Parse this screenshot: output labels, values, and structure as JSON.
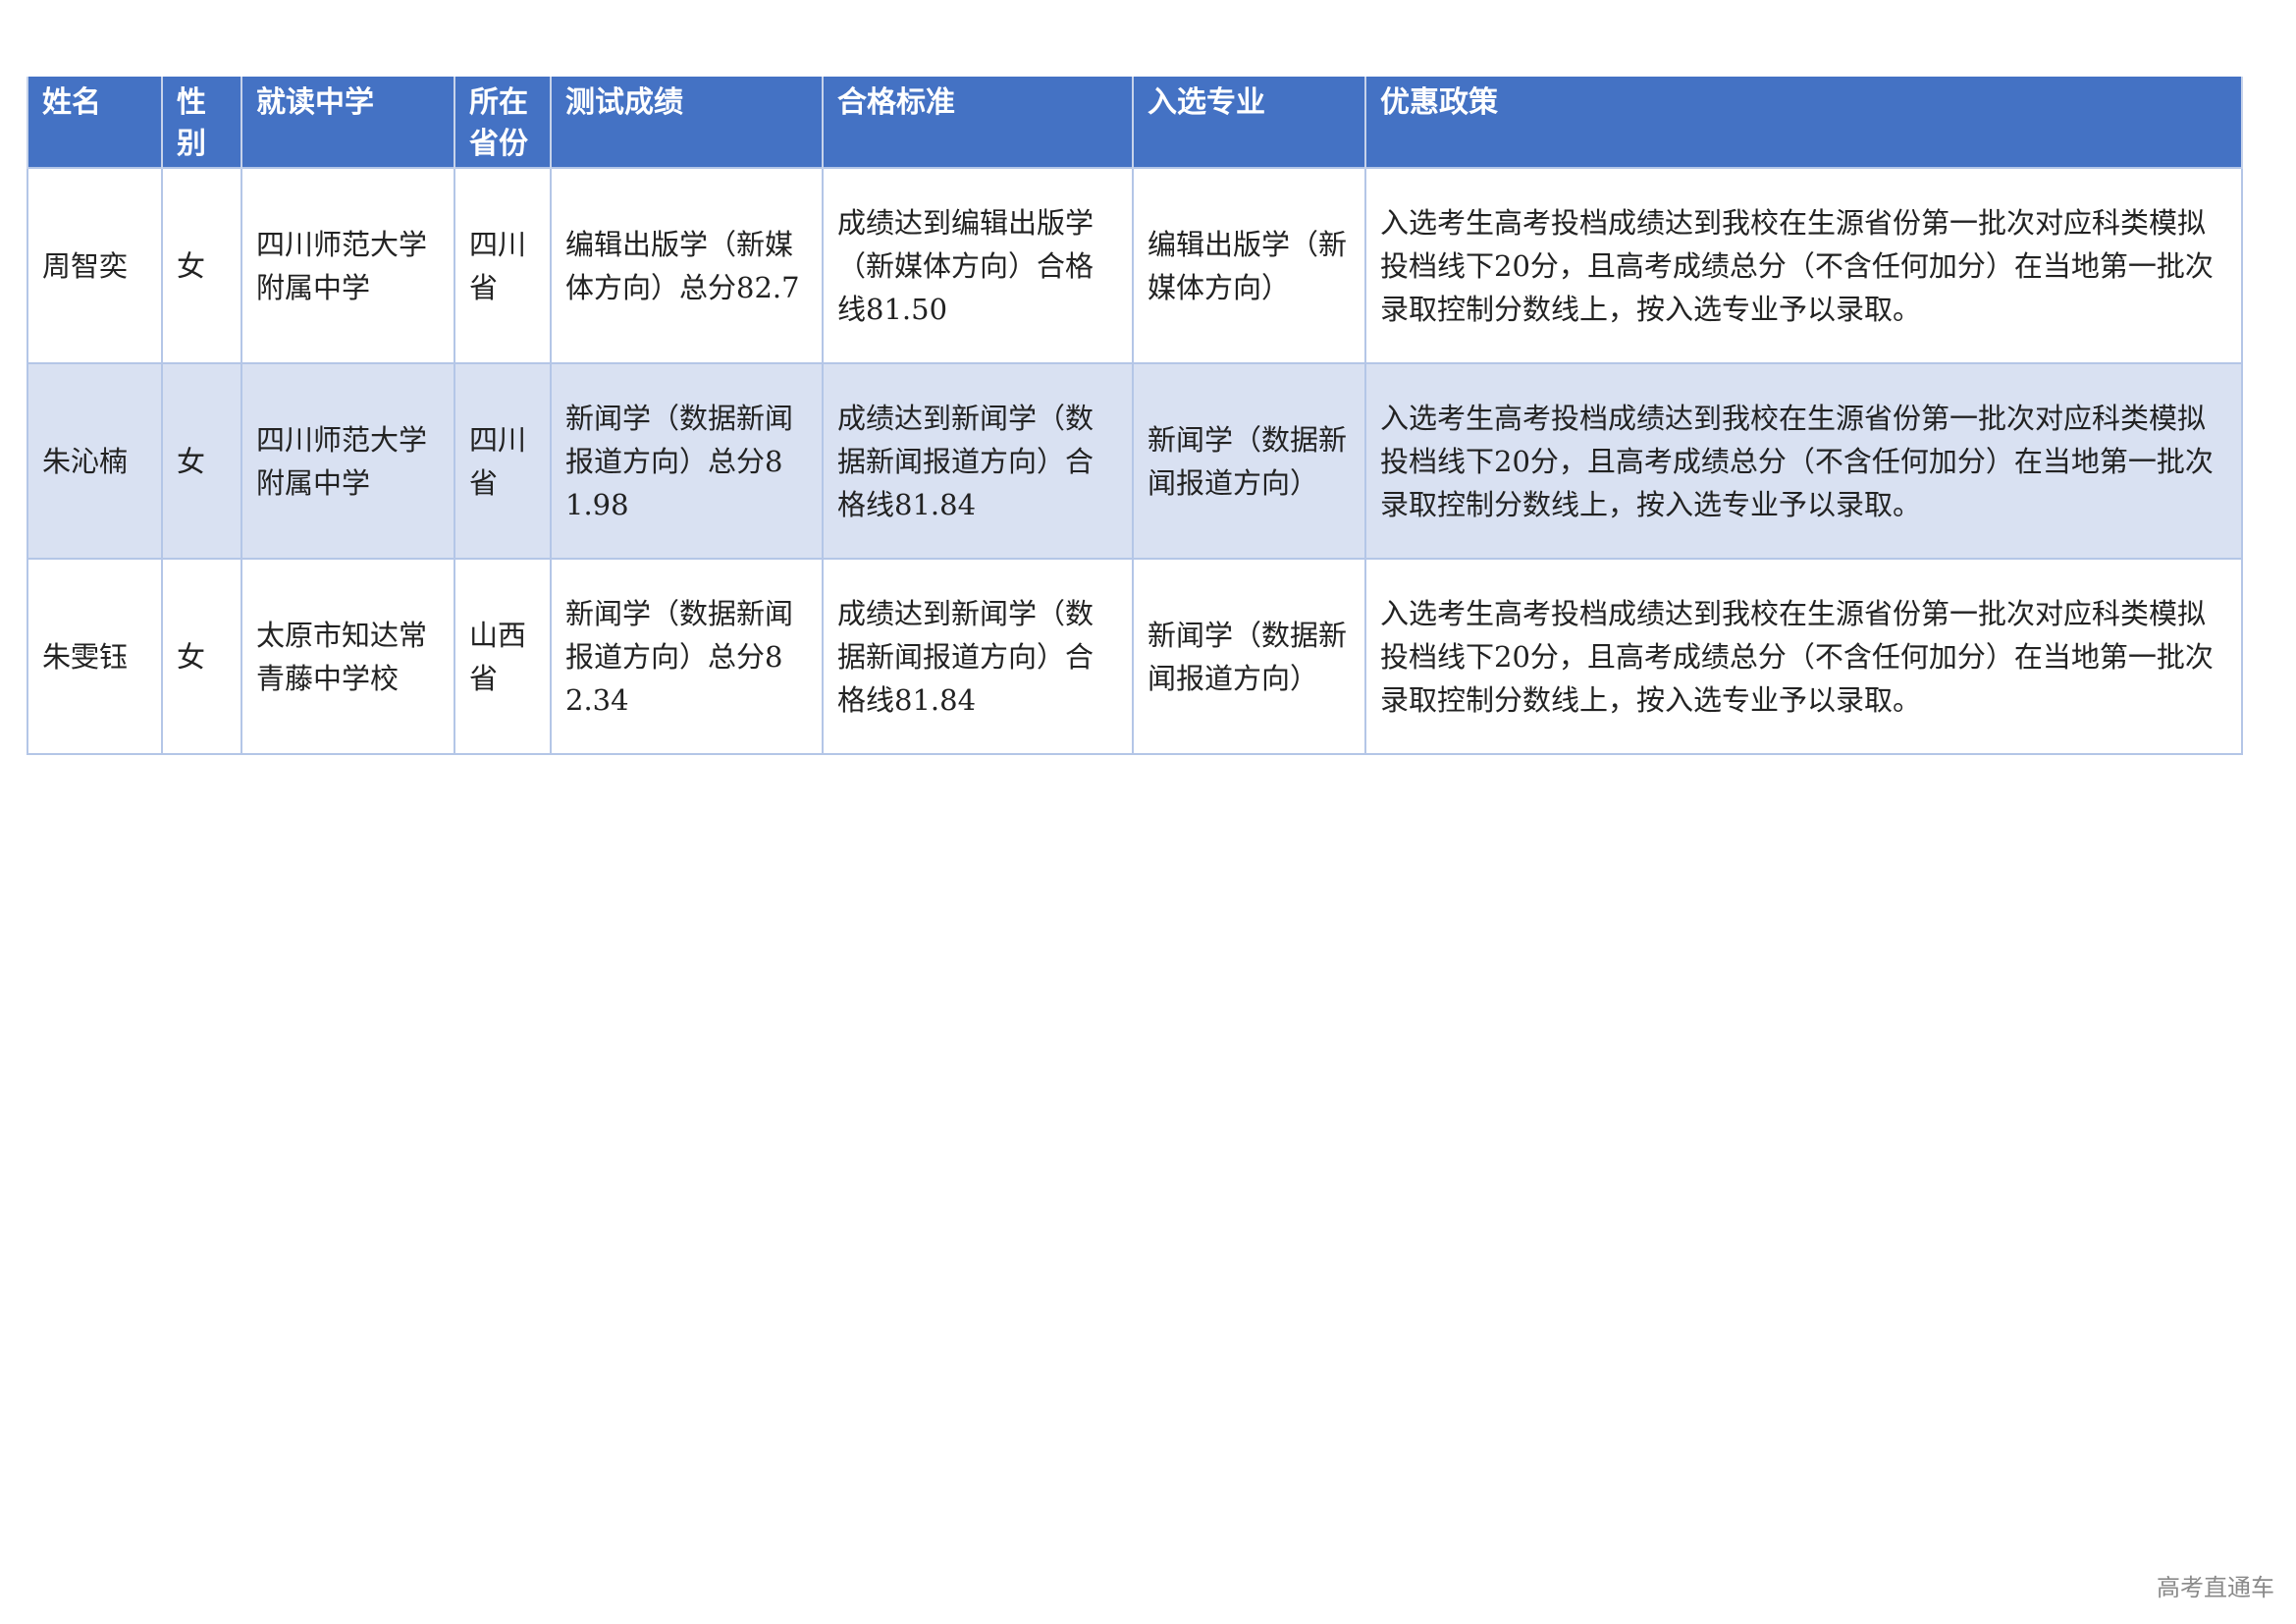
{
  "table": {
    "headers": {
      "name": "姓名",
      "gender": "性别",
      "school": "就读中学",
      "province": "所在省份",
      "score": "测试成绩",
      "standard": "合格标准",
      "major": "入选专业",
      "policy": "优惠政策"
    },
    "rows": [
      {
        "name": "周智奕",
        "gender": "女",
        "school": "四川师范大学附属中学",
        "province": "四川省",
        "score": "编辑出版学（新媒体方向）总分82.7",
        "standard": "成绩达到编辑出版学（新媒体方向）合格线81.50",
        "major": "编辑出版学（新媒体方向）",
        "policy": "入选考生高考投档成绩达到我校在生源省份第一批次对应科类模拟投档线下20分，且高考成绩总分（不含任何加分）在当地第一批次录取控制分数线上，按入选专业予以录取。"
      },
      {
        "name": "朱沁楠",
        "gender": "女",
        "school": "四川师范大学附属中学",
        "province": "四川省",
        "score": "新闻学（数据新闻报道方向）总分81.98",
        "standard": "成绩达到新闻学（数据新闻报道方向）合格线81.84",
        "major": "新闻学（数据新闻报道方向）",
        "policy": "入选考生高考投档成绩达到我校在生源省份第一批次对应科类模拟投档线下20分，且高考成绩总分（不含任何加分）在当地第一批次录取控制分数线上，按入选专业予以录取。"
      },
      {
        "name": "朱雯钰",
        "gender": "女",
        "school": "太原市知达常青藤中学校",
        "province": "山西省",
        "score": "新闻学（数据新闻报道方向）总分82.34",
        "standard": "成绩达到新闻学（数据新闻报道方向）合格线81.84",
        "major": "新闻学（数据新闻报道方向）",
        "policy": "入选考生高考投档成绩达到我校在生源省份第一批次对应科类模拟投档线下20分，且高考成绩总分（不含任何加分）在当地第一批次录取控制分数线上，按入选专业予以录取。"
      }
    ]
  },
  "footer": {
    "watermark": "高考直通车"
  }
}
